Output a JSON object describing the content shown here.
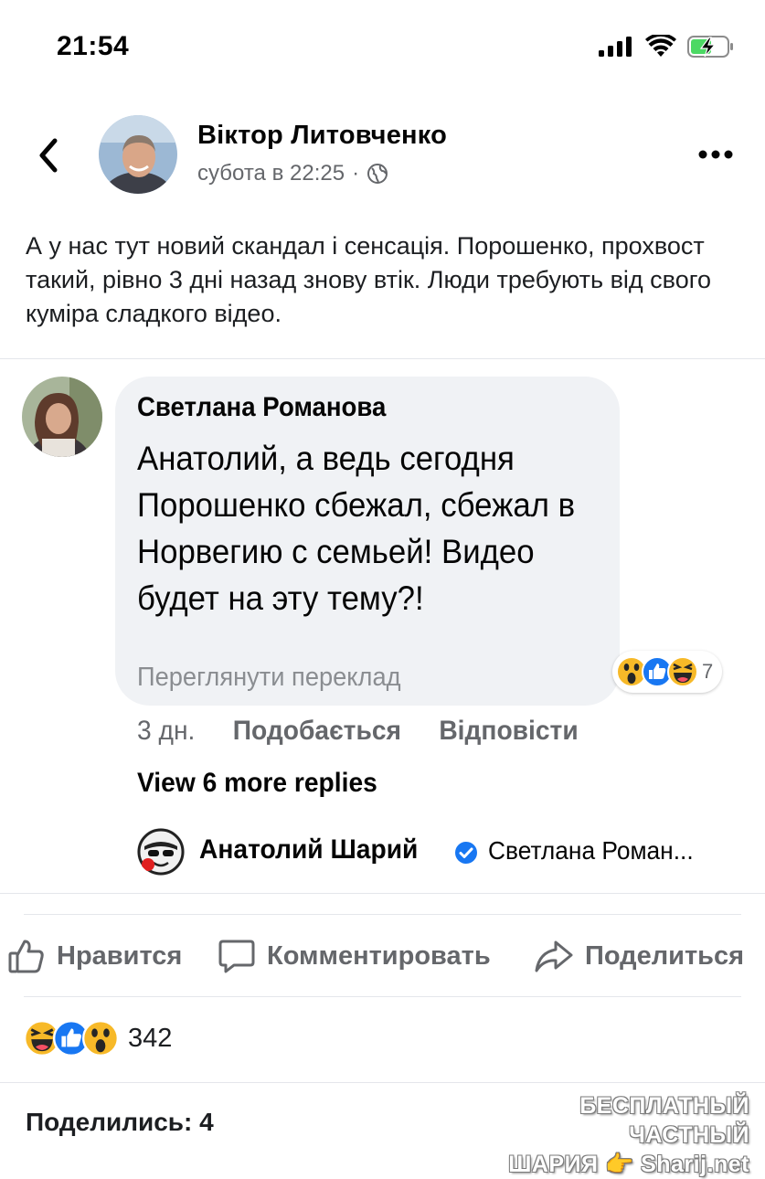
{
  "status_bar": {
    "time": "21:54"
  },
  "post": {
    "author": "Віктор Литовченко",
    "timestamp": "субота в 22:25",
    "separator": "·",
    "privacy_icon": "globe-icon",
    "text": "А у нас тут новий скандал і сенсація. Порошенко, прохвост такий, рівно 3 дні назад знову втік. Люди требують від свого куміра сладкого відео."
  },
  "embedded_comment": {
    "author": "Светлана Романова",
    "text": "Анатолий, а ведь сегодня Порошенко сбежал, сбежал в Норвегию с семьей! Видео будет  на эту тему?!",
    "translate": "Переглянути переклад",
    "reaction_icons": [
      "wow-icon",
      "like-icon",
      "haha-icon"
    ],
    "reaction_count": "7",
    "age": "3 дн.",
    "like_label": "Подобається",
    "reply_label": "Відповісти",
    "view_more": "View 6 more replies",
    "reply": {
      "author": "Анатолий Шарий",
      "text": "Светлана Роман..."
    }
  },
  "actions": {
    "like": "Нравится",
    "comment": "Комментировать",
    "share": "Поделиться"
  },
  "reactions": {
    "icons": [
      "haha-icon",
      "like-icon",
      "wow-icon"
    ],
    "count": "342"
  },
  "shares": "Поделились: 4",
  "watermark": {
    "line1": "БЕСПЛАТНЫЙ ЧАСТНЫЙ",
    "line2": "ШАРИЯ",
    "site": "Sharij.net"
  },
  "colors": {
    "text": "#1c1e21",
    "secondary": "#65676b",
    "like_blue": "#1877f2",
    "emoji_yellow": "#f7b928",
    "bubble_bg": "#f0f2f5"
  }
}
